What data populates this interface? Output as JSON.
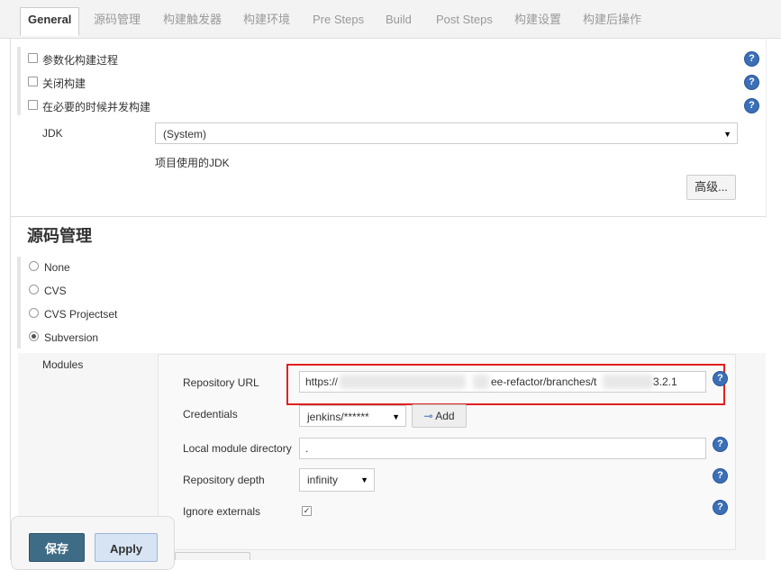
{
  "tabs": [
    "General",
    "源码管理",
    "构建触发器",
    "构建环境",
    "Pre Steps",
    "Build",
    "Post Steps",
    "构建设置",
    "构建后操作"
  ],
  "general": {
    "options": [
      {
        "label": "参数化构建过程",
        "checked": false
      },
      {
        "label": "关闭构建",
        "checked": false
      },
      {
        "label": "在必要的时候并发构建",
        "checked": false
      }
    ],
    "jdk_label": "JDK",
    "jdk_value": "(System)",
    "jdk_hint": "项目使用的JDK",
    "advanced_button": "高级..."
  },
  "scm": {
    "title": "源码管理",
    "options": [
      {
        "label": "None",
        "selected": false
      },
      {
        "label": "CVS",
        "selected": false
      },
      {
        "label": "CVS Projectset",
        "selected": false
      },
      {
        "label": "Subversion",
        "selected": true
      }
    ],
    "modules_label": "Modules",
    "repo_url_label": "Repository URL",
    "repo_url_prefix": "https://",
    "repo_url_mid": "ee-refactor/branches/t",
    "repo_url_suffix": "3.2.1",
    "credentials_label": "Credentials",
    "credentials_value": "jenkins/******",
    "add_button": "Add",
    "local_dir_label": "Local module directory",
    "local_dir_value": ".",
    "depth_label": "Repository depth",
    "depth_value": "infinity",
    "ignore_label": "Ignore externals",
    "ignore_checked": true
  },
  "icons": {
    "help": "help-icon",
    "dropdown": "chevron-down-icon",
    "key": "key-icon"
  },
  "footer": {
    "save_button": "保存",
    "apply_button": "Apply"
  },
  "help_glyph": "?"
}
